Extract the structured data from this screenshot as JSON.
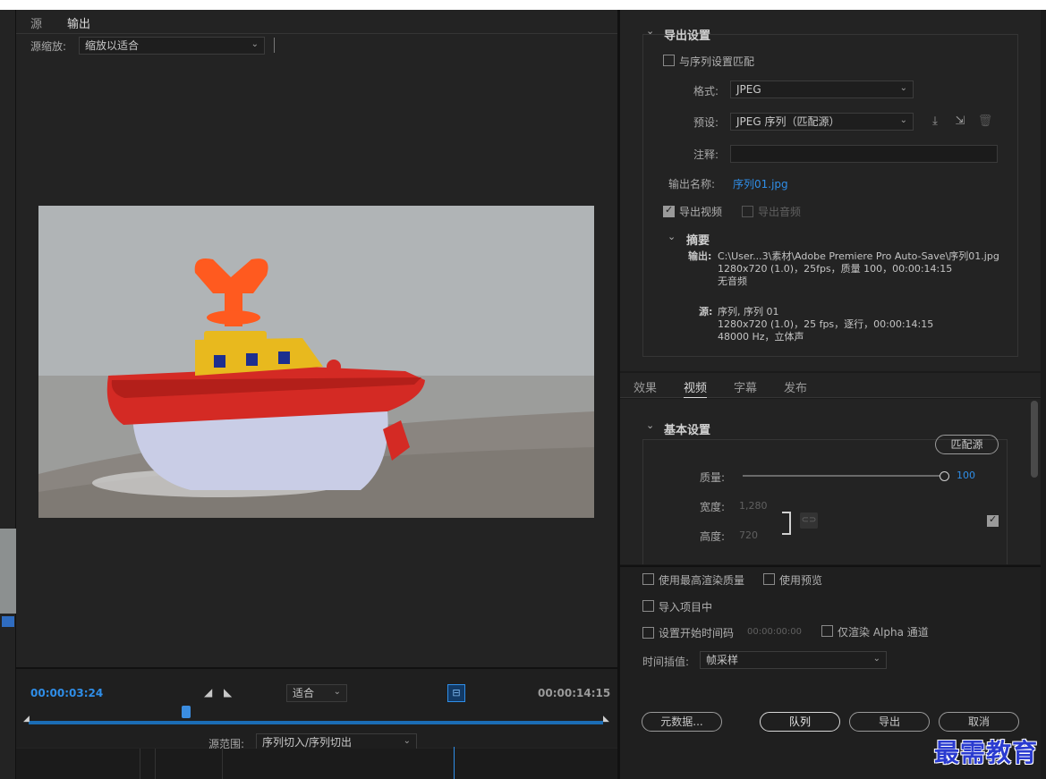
{
  "source_panel": {
    "tabs": [
      "源",
      "输出"
    ],
    "source_scale_label": "源缩放:",
    "source_scale_value": "缩放以适合"
  },
  "preview": {
    "current_time": "00:00:03:24",
    "fit_value": "适合",
    "end_time": "00:00:14:15",
    "source_range_label": "源范围:",
    "source_range_value": "序列切入/序列切出"
  },
  "export_settings": {
    "heading": "导出设置",
    "match_sequence": "与序列设置匹配",
    "format_label": "格式:",
    "format_value": "JPEG",
    "preset_label": "预设:",
    "preset_value": "JPEG 序列（匹配源）",
    "comment_label": "注释:",
    "output_name_label": "输出名称:",
    "output_name_value": "序列01.jpg",
    "export_video": "导出视频",
    "export_audio": "导出音频"
  },
  "summary": {
    "heading": "摘要",
    "output_label": "输出:",
    "output_line1": "C:\\User...3\\素材\\Adobe Premiere Pro Auto-Save\\序列01.jpg",
    "output_line2": "1280x720 (1.0)，25fps，质量 100，00:00:14:15",
    "output_line3": "无音频",
    "source_label": "源:",
    "source_line1": "序列, 序列 01",
    "source_line2": "1280x720 (1.0)，25 fps，逐行，00:00:14:15",
    "source_line3": "48000 Hz，立体声"
  },
  "settings_tabs": [
    "效果",
    "视频",
    "字幕",
    "发布"
  ],
  "basic_settings": {
    "heading": "基本设置",
    "match_source_button": "匹配源",
    "quality_label": "质量:",
    "quality_value": "100",
    "width_label": "宽度:",
    "width_value": "1,280",
    "height_label": "高度:",
    "height_value": "720"
  },
  "render_options": {
    "max_render_quality": "使用最高渲染质量",
    "use_previews": "使用预览",
    "import_into_project": "导入项目中",
    "set_start_timecode": "设置开始时间码",
    "start_timecode_value": "00:00:00:00",
    "render_alpha_only": "仅渲染 Alpha 通道",
    "time_interpolation_label": "时间插值:",
    "time_interpolation_value": "帧采样"
  },
  "buttons": {
    "metadata": "元数据...",
    "queue": "队列",
    "export": "导出",
    "cancel": "取消"
  },
  "watermark": "最需教育",
  "colors": {
    "accent": "#2f8ee8",
    "panel": "#232323",
    "background": "#1b1b1b"
  }
}
